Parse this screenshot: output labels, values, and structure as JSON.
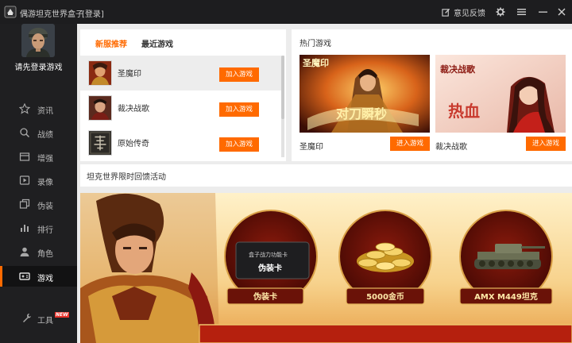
{
  "app": {
    "title": "偶游坦克世界盒子",
    "login_link": "[登录]",
    "feedback_label": "意见反馈"
  },
  "sidebar": {
    "login_prompt": "请先登录游戏",
    "items": [
      {
        "label": "资讯",
        "icon": "star-icon"
      },
      {
        "label": "战绩",
        "icon": "search-icon"
      },
      {
        "label": "增强",
        "icon": "box-icon"
      },
      {
        "label": "录像",
        "icon": "video-icon"
      },
      {
        "label": "伪装",
        "icon": "layers-icon"
      },
      {
        "label": "排行",
        "icon": "bar-chart-icon"
      },
      {
        "label": "角色",
        "icon": "user-icon"
      },
      {
        "label": "游戏",
        "icon": "gamepad-icon",
        "active": true
      }
    ],
    "tools_label": "工具",
    "tools_badge": "NEW"
  },
  "left_panel": {
    "tabs": [
      "新服推荐",
      "最近游戏"
    ],
    "active_tab": "新服推荐",
    "games": [
      {
        "name": "圣魔印",
        "button": "加入游戏"
      },
      {
        "name": "裁决战歌",
        "button": "加入游戏"
      },
      {
        "name": "原始传奇",
        "button": "加入游戏"
      }
    ]
  },
  "hot_panel": {
    "title": "热门游戏",
    "games": [
      {
        "name": "圣魔印",
        "button": "进入游戏"
      },
      {
        "name": "裁决战歌",
        "button": "进入游戏"
      }
    ]
  },
  "promo": {
    "title": "坦克世界限时回馈活动",
    "badges": [
      {
        "label": "伪装卡",
        "card_top": "盒子战力功能卡",
        "card_main": "伪装卡"
      },
      {
        "label": "5000金币"
      },
      {
        "label": "AMX M449坦克"
      }
    ]
  },
  "colors": {
    "accent": "#ff6a00",
    "sidebar_bg": "#1f1f21",
    "titlebar_bg": "#1d1d1f"
  }
}
